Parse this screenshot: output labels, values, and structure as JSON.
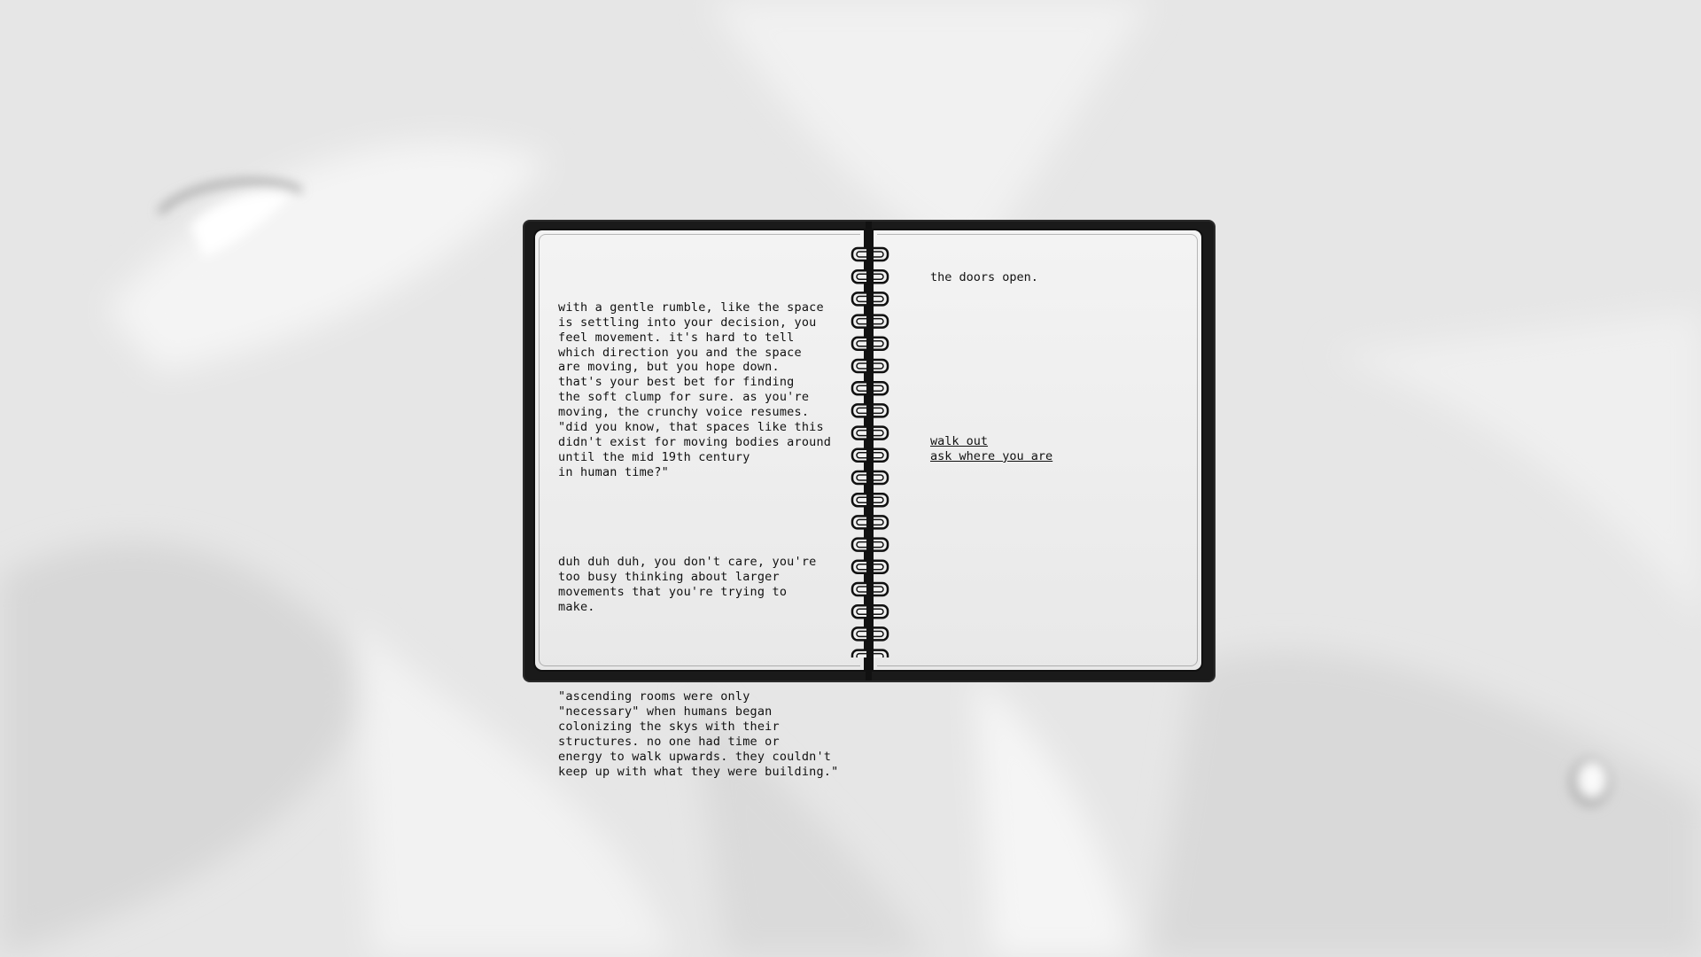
{
  "left_page": {
    "paragraph_1": "with a gentle rumble, like the space\nis settling into your decision, you\nfeel movement. it's hard to tell\nwhich direction you and the space\nare moving, but you hope down.\nthat's your best bet for finding\nthe soft clump for sure. as you're\nmoving, the crunchy voice resumes.\n\"did you know, that spaces like this\ndidn't exist for moving bodies around\nuntil the mid 19th century\nin human time?\"",
    "paragraph_2": "duh duh duh, you don't care, you're\ntoo busy thinking about larger\nmovements that you're trying to\nmake.",
    "paragraph_3": "\"ascending rooms were only\n\"necessary\" when humans began\ncolonizing the skys with their\nstructures. no one had time or\nenergy to walk upwards. they couldn't\nkeep up with what they were building.\""
  },
  "right_page": {
    "text": "the doors open.",
    "choices": [
      {
        "label": "walk out"
      },
      {
        "label": "ask where you are"
      }
    ]
  }
}
